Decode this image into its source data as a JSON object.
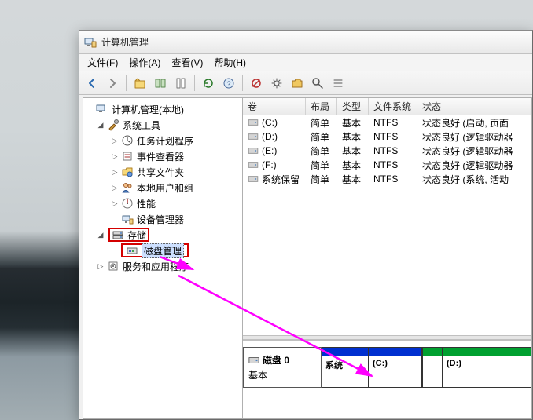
{
  "window": {
    "title": "计算机管理"
  },
  "menus": {
    "file": "文件(F)",
    "action": "操作(A)",
    "view": "查看(V)",
    "help": "帮助(H)"
  },
  "tree": {
    "root": "计算机管理(本地)",
    "system_tools": {
      "label": "系统工具",
      "task_scheduler": "任务计划程序",
      "event_viewer": "事件查看器",
      "shared_folders": "共享文件夹",
      "local_users": "本地用户和组",
      "performance": "性能",
      "device_manager": "设备管理器"
    },
    "storage": {
      "label": "存储",
      "disk_management": "磁盘管理"
    },
    "services": {
      "label": "服务和应用程序"
    }
  },
  "grid": {
    "headers": {
      "volume": "卷",
      "layout": "布局",
      "type": "类型",
      "filesystem": "文件系统",
      "status": "状态"
    },
    "rows": [
      {
        "vol": "(C:)",
        "layout": "简单",
        "type": "基本",
        "fs": "NTFS",
        "status": "状态良好 (启动, 页面"
      },
      {
        "vol": "(D:)",
        "layout": "简单",
        "type": "基本",
        "fs": "NTFS",
        "status": "状态良好 (逻辑驱动器"
      },
      {
        "vol": "(E:)",
        "layout": "简单",
        "type": "基本",
        "fs": "NTFS",
        "status": "状态良好 (逻辑驱动器"
      },
      {
        "vol": "(F:)",
        "layout": "简单",
        "type": "基本",
        "fs": "NTFS",
        "status": "状态良好 (逻辑驱动器"
      },
      {
        "vol": "系统保留",
        "layout": "简单",
        "type": "基本",
        "fs": "NTFS",
        "status": "状态良好 (系统, 活动"
      }
    ]
  },
  "diskmap": {
    "disk_label": "磁盘 0",
    "disk_type": "基本",
    "partitions": {
      "system": "系统",
      "c": "(C:)",
      "d": "(D:)"
    }
  },
  "colors": {
    "highlight": "#d40000",
    "arrow": "#ff00ff",
    "partition_blue": "#0030d0",
    "partition_green": "#00a030"
  }
}
